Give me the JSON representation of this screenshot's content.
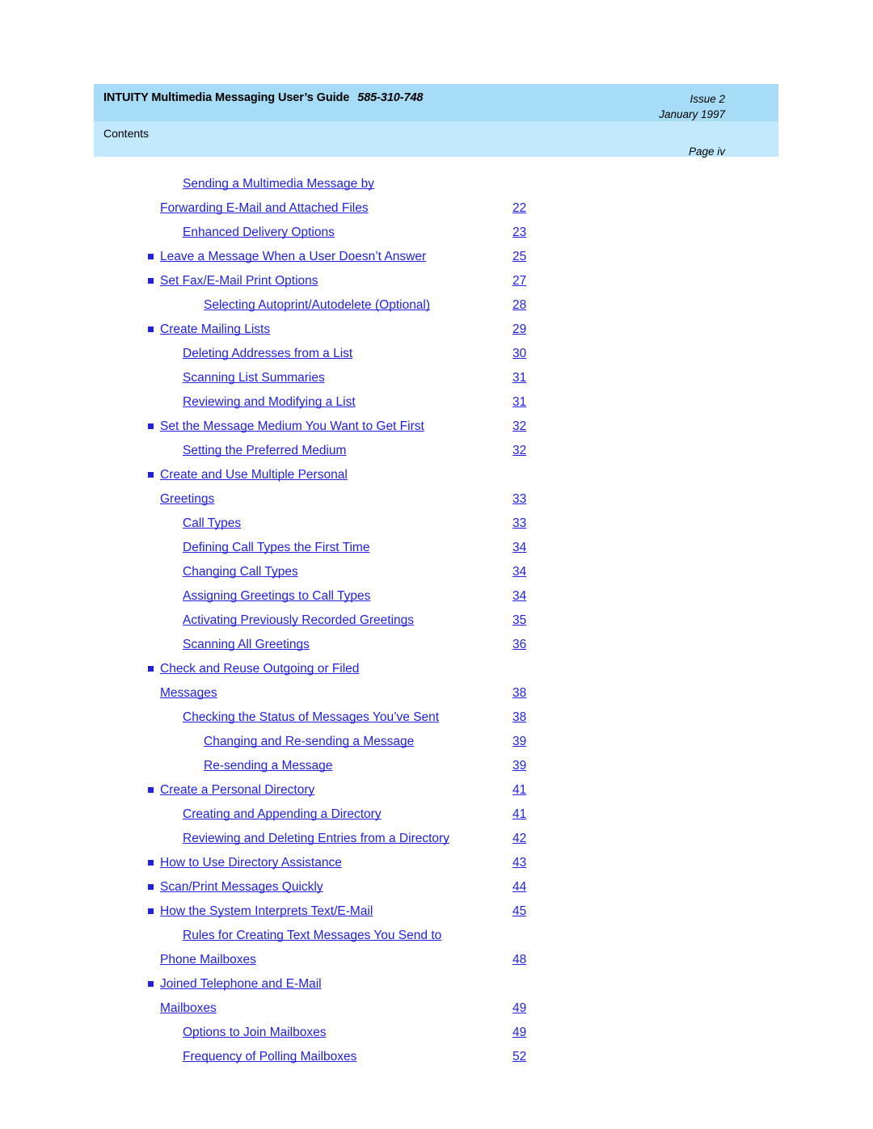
{
  "header": {
    "title": "INTUITY Multimedia Messaging User’s Guide",
    "doc_number": "585-310-748",
    "issue": "Issue 2",
    "date": "January 1997",
    "section": "Contents",
    "page_label": "Page iv",
    "band_top_color": "#a6dcf5",
    "band_bottom_color": "#c3e9fc"
  },
  "link_color": "#2222dd",
  "toc": {
    "entries": [
      {
        "level": 2,
        "bullet": false,
        "line_a": "Sending a Multimedia Message by",
        "line_b": "Forwarding E-Mail and Attached Files",
        "page": "22"
      },
      {
        "level": 2,
        "bullet": false,
        "label": "Enhanced Delivery Options",
        "page": "23"
      },
      {
        "level": 1,
        "bullet": true,
        "label": "Leave a Message When a User Doesn’t Answer",
        "page": "25"
      },
      {
        "level": 1,
        "bullet": true,
        "label": "Set Fax/E-Mail Print Options",
        "page": "27"
      },
      {
        "level": 3,
        "bullet": false,
        "label": "Selecting Autoprint/Autodelete (Optional)",
        "page": "28"
      },
      {
        "level": 1,
        "bullet": true,
        "label": "Create Mailing Lists",
        "page": "29"
      },
      {
        "level": 2,
        "bullet": false,
        "label": "Deleting Addresses from a List",
        "page": "30"
      },
      {
        "level": 2,
        "bullet": false,
        "label": "Scanning List Summaries",
        "page": "31"
      },
      {
        "level": 2,
        "bullet": false,
        "label": "Reviewing and Modifying a List",
        "page": "31"
      },
      {
        "level": 1,
        "bullet": true,
        "label": "Set the Message Medium You Want to Get First",
        "page": "32"
      },
      {
        "level": 2,
        "bullet": false,
        "label": "Setting the Preferred Medium",
        "page": "32"
      },
      {
        "level": 1,
        "bullet": true,
        "line_a": "Create and Use Multiple Personal",
        "line_b": "Greetings",
        "page": "33"
      },
      {
        "level": 2,
        "bullet": false,
        "label": "Call Types",
        "page": "33"
      },
      {
        "level": 2,
        "bullet": false,
        "label": "Defining Call Types the First Time",
        "page": "34"
      },
      {
        "level": 2,
        "bullet": false,
        "label": "Changing Call Types",
        "page": "34"
      },
      {
        "level": 2,
        "bullet": false,
        "label": "Assigning Greetings to Call Types",
        "page": "34"
      },
      {
        "level": 2,
        "bullet": false,
        "label": "Activating Previously Recorded Greetings",
        "page": "35"
      },
      {
        "level": 2,
        "bullet": false,
        "label": "Scanning All Greetings",
        "page": "36"
      },
      {
        "level": 1,
        "bullet": true,
        "line_a": "Check and Reuse Outgoing or Filed",
        "line_b": "Messages",
        "page": "38"
      },
      {
        "level": 2,
        "bullet": false,
        "label": "Checking the Status of Messages You’ve Sent",
        "page": "38"
      },
      {
        "level": 3,
        "bullet": false,
        "label": "Changing and Re-sending a Message",
        "page": "39"
      },
      {
        "level": 3,
        "bullet": false,
        "label": "Re-sending a Message",
        "page": "39"
      },
      {
        "level": 1,
        "bullet": true,
        "label": "Create a Personal Directory",
        "page": "41"
      },
      {
        "level": 2,
        "bullet": false,
        "label": "Creating and Appending a Directory",
        "page": "41"
      },
      {
        "level": 2,
        "bullet": false,
        "label": "Reviewing and Deleting Entries from a Directory",
        "page": "42"
      },
      {
        "level": 1,
        "bullet": true,
        "label": "How to Use Directory Assistance",
        "page": "43"
      },
      {
        "level": 1,
        "bullet": true,
        "label": "Scan/Print Messages Quickly",
        "page": "44"
      },
      {
        "level": 1,
        "bullet": true,
        "label": "How the System Interprets Text/E-Mail",
        "page": "45"
      },
      {
        "level": 2,
        "bullet": false,
        "line_a": "Rules for Creating Text Messages You Send to",
        "line_b": "Phone Mailboxes",
        "page": "48"
      },
      {
        "level": 1,
        "bullet": true,
        "line_a": "Joined Telephone and E-Mail",
        "line_b": "Mailboxes",
        "page": "49"
      },
      {
        "level": 2,
        "bullet": false,
        "label": "Options to Join Mailboxes",
        "page": "49"
      },
      {
        "level": 2,
        "bullet": false,
        "label": "Frequency of Polling Mailboxes",
        "page": "52"
      }
    ]
  }
}
